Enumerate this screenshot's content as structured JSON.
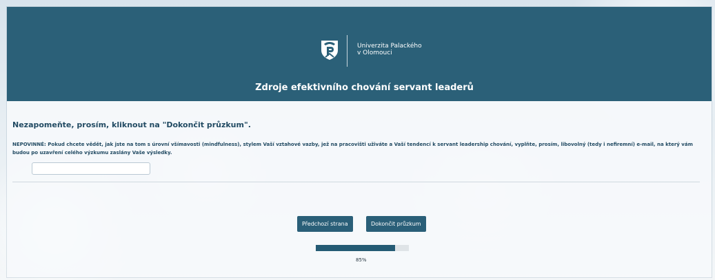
{
  "header": {
    "university_line1": "Univerzita Palackého",
    "university_line2": "v Olomouci",
    "survey_title": "Zdroje efektivního chování servant leaderů"
  },
  "content": {
    "reminder": "Nezapomeňte, prosím, kliknout na \"Dokončit průzkum\".",
    "optional_text": "NEPOVINNÉ: Pokud chcete vědět, jak jste na tom s úrovní všímavosti (mindfulness), stylem Vaší vztahové vazby, jež na pracovišti uživáte a Vaší tendencí k servant leadership chování, vyplňte, prosím, libovolný (tedy i nefiremní) e-mail, na který vám budou po uzavření celého výzkumu zaslány Vaše výsledky.",
    "email_value": "",
    "email_placeholder": ""
  },
  "navigation": {
    "previous_label": "Předchozí strana",
    "finish_label": "Dokončit průzkum"
  },
  "progress": {
    "value": 0.85,
    "label": "85%"
  },
  "colors": {
    "header": "#2b6078",
    "accent": "#2a5f78",
    "text": "#224b63"
  },
  "icons": {
    "logo": "university-crest-icon"
  }
}
